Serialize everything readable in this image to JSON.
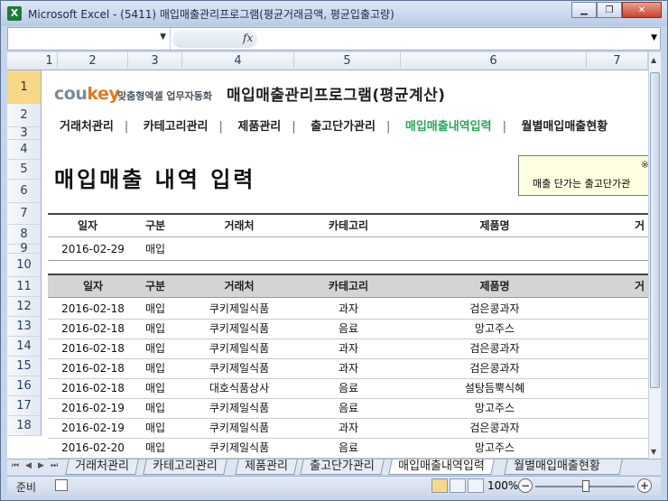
{
  "window": {
    "title": "Microsoft Excel - (5411) 매입매출관리프로그램(평균거래금액, 평균입출고량)",
    "app_icon": "X"
  },
  "formula_bar": {
    "name_box": "",
    "fx_label": "fx",
    "formula": ""
  },
  "columns": [
    "1",
    "2",
    "3",
    "4",
    "5",
    "6",
    "7"
  ],
  "rows": [
    "1",
    "2",
    "3",
    "4",
    "5",
    "6",
    "7",
    "8",
    "9",
    "10",
    "11",
    "12",
    "13",
    "14",
    "15",
    "16",
    "17",
    "18"
  ],
  "sheet": {
    "logo_main": "cou",
    "logo_accent": "key",
    "logo_sub": "맞춤형엑셀 업무자동화",
    "app_title": "매입매출관리프로그램(평균계산)",
    "nav": [
      "거래처관리",
      "카테고리관리",
      "제품관리",
      "출고단가관리",
      "매입매출내역입력",
      "월별매입매출현황"
    ],
    "nav_active_index": 4,
    "page_title": "매입매출 내역 입력",
    "note_mark": "※",
    "note_text": "매출 단가는 출고단가관",
    "input_headers": [
      "일자",
      "구분",
      "거래처",
      "카테고리",
      "제품명",
      "거"
    ],
    "input_row": {
      "date": "2016-02-29",
      "type": "매입",
      "vendor": "",
      "category": "",
      "product": ""
    },
    "list_headers": [
      "일자",
      "구분",
      "거래처",
      "카테고리",
      "제품명",
      "거"
    ],
    "records": [
      {
        "date": "2016-02-18",
        "type": "매입",
        "vendor": "쿠키제일식품",
        "category": "과자",
        "product": "검은콩과자"
      },
      {
        "date": "2016-02-18",
        "type": "매입",
        "vendor": "쿠키제일식품",
        "category": "음료",
        "product": "망고주스"
      },
      {
        "date": "2016-02-18",
        "type": "매입",
        "vendor": "쿠키제일식품",
        "category": "과자",
        "product": "검은콩과자"
      },
      {
        "date": "2016-02-18",
        "type": "매입",
        "vendor": "쿠키제일식품",
        "category": "과자",
        "product": "검은콩과자"
      },
      {
        "date": "2016-02-18",
        "type": "매입",
        "vendor": "대호식품상사",
        "category": "음료",
        "product": "설탕듬뿍식혜"
      },
      {
        "date": "2016-02-19",
        "type": "매입",
        "vendor": "쿠키제일식품",
        "category": "음료",
        "product": "망고주스"
      },
      {
        "date": "2016-02-19",
        "type": "매입",
        "vendor": "쿠키제일식품",
        "category": "과자",
        "product": "검은콩과자"
      },
      {
        "date": "2016-02-20",
        "type": "매입",
        "vendor": "쿠키제일식품",
        "category": "음료",
        "product": "망고주스"
      }
    ]
  },
  "tabs": [
    "거래처관리",
    "카테고리관리",
    "제품관리",
    "출고단가관리",
    "매입매출내역입력",
    "월별매입매출현황"
  ],
  "active_tab_index": 4,
  "status": {
    "ready": "준비",
    "zoom": "100%"
  },
  "colors": {
    "accent_green": "#2ea35a",
    "logo_orange": "#e07a1c",
    "header_gray": "#d4d4d4"
  }
}
